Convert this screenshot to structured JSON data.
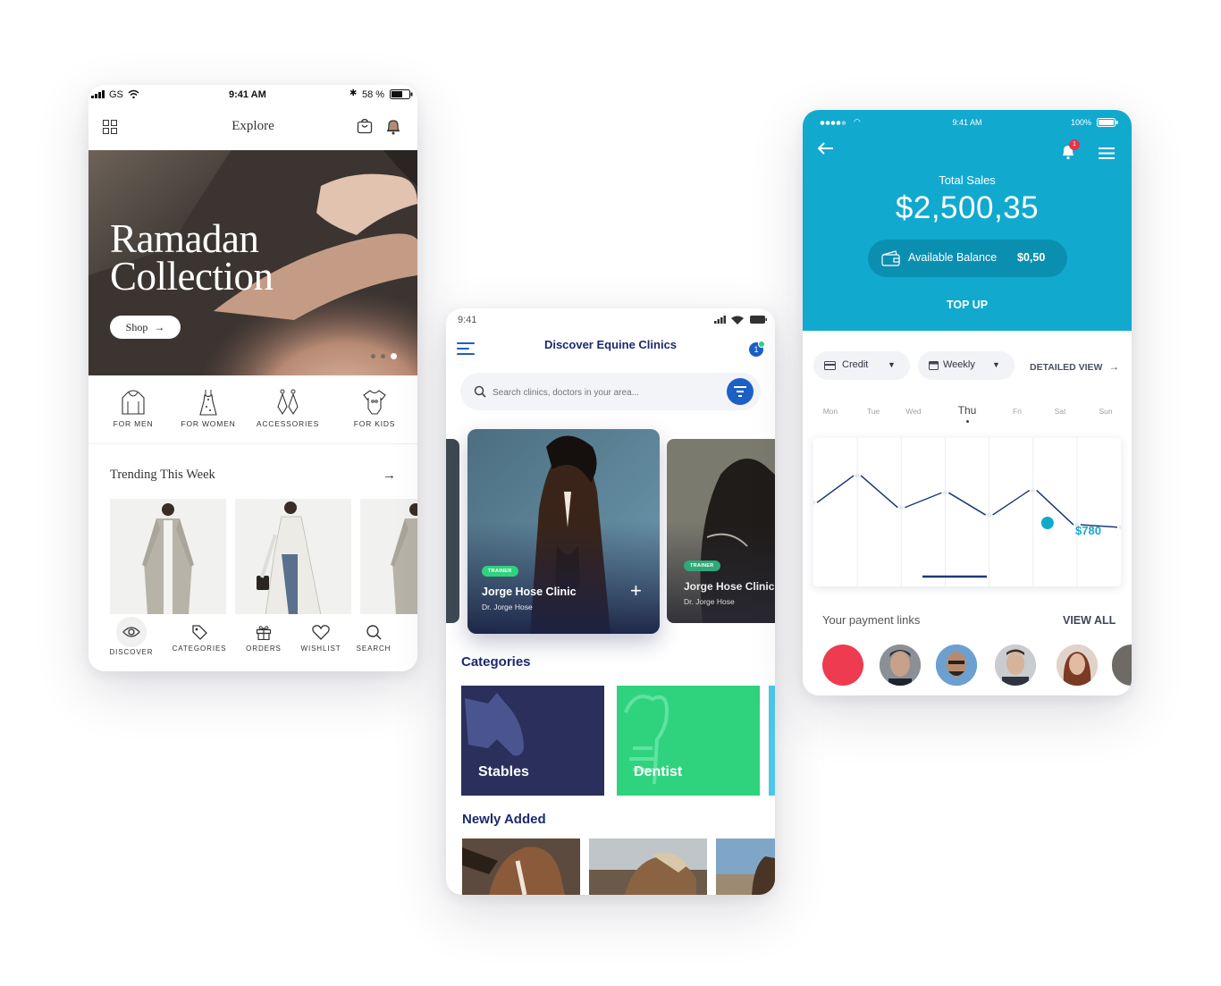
{
  "fashion": {
    "status": {
      "carrier": "GS",
      "time": "9:41 AM",
      "battery": "58 %"
    },
    "header": {
      "title": "Explore"
    },
    "hero": {
      "line1": "Ramadan",
      "line2": "Collection",
      "shop_label": "Shop"
    },
    "categories": [
      {
        "label": "FOR MEN",
        "icon": "hoodie-icon"
      },
      {
        "label": "FOR WOMEN",
        "icon": "dress-icon"
      },
      {
        "label": "ACCESSORIES",
        "icon": "earrings-icon"
      },
      {
        "label": "FOR KIDS",
        "icon": "onesie-icon"
      }
    ],
    "trending": {
      "title": "Trending This Week"
    },
    "bottom_nav": [
      {
        "label": "DISCOVER",
        "icon": "eye-icon"
      },
      {
        "label": "CATEGORIES",
        "icon": "tag-icon"
      },
      {
        "label": "ORDERS",
        "icon": "gift-icon"
      },
      {
        "label": "WISHLIST",
        "icon": "heart-icon"
      },
      {
        "label": "SEARCH",
        "icon": "search-icon"
      }
    ]
  },
  "equine": {
    "status": {
      "time": "9:41"
    },
    "header": {
      "title": "Discover Equine Clinics",
      "notification_count": "1"
    },
    "search": {
      "placeholder": "Search clinics, doctors in your area..."
    },
    "featured": [
      {
        "badge": "TRAINER",
        "name": "Jorge Hose Clinic",
        "doctor": "Dr. Jorge Hose"
      },
      {
        "badge": "TRAINER",
        "name": "Jorge Hose Clinic",
        "doctor": "Dr. Jorge Hose"
      }
    ],
    "categories_title": "Categories",
    "categories": [
      {
        "label": "Stables",
        "color": "#2b2f5c"
      },
      {
        "label": "Dentist",
        "color": "#2fd37e"
      }
    ],
    "newly_added_title": "Newly Added"
  },
  "finance": {
    "status": {
      "time": "9:41 AM",
      "battery": "100%"
    },
    "notification_count": "1",
    "total_label": "Total Sales",
    "total_value": "$2,500,35",
    "balance_label": "Available Balance",
    "balance_value": "$0,50",
    "topup_label": "TOP UP",
    "filters": {
      "type": "Credit",
      "period": "Weekly",
      "detailed_label": "DETAILED VIEW"
    },
    "days": [
      "Mon",
      "Tue",
      "Wed",
      "Thu",
      "Fri",
      "Sat",
      "Sun"
    ],
    "selected_day": "Thu",
    "chart_value_label": "$780",
    "payment_title": "Your payment links",
    "view_all": "VIEW ALL",
    "accent": "#12a9cf"
  },
  "chart_data": {
    "type": "line",
    "x": [
      "Mon",
      "Tue",
      "Wed",
      "Thu",
      "Fri",
      "Sat",
      "Sun"
    ],
    "series": [
      {
        "values": [
          61,
          72,
          59,
          65,
          56,
          66,
          52,
          51
        ]
      }
    ],
    "highlight": {
      "value": "$780"
    }
  }
}
